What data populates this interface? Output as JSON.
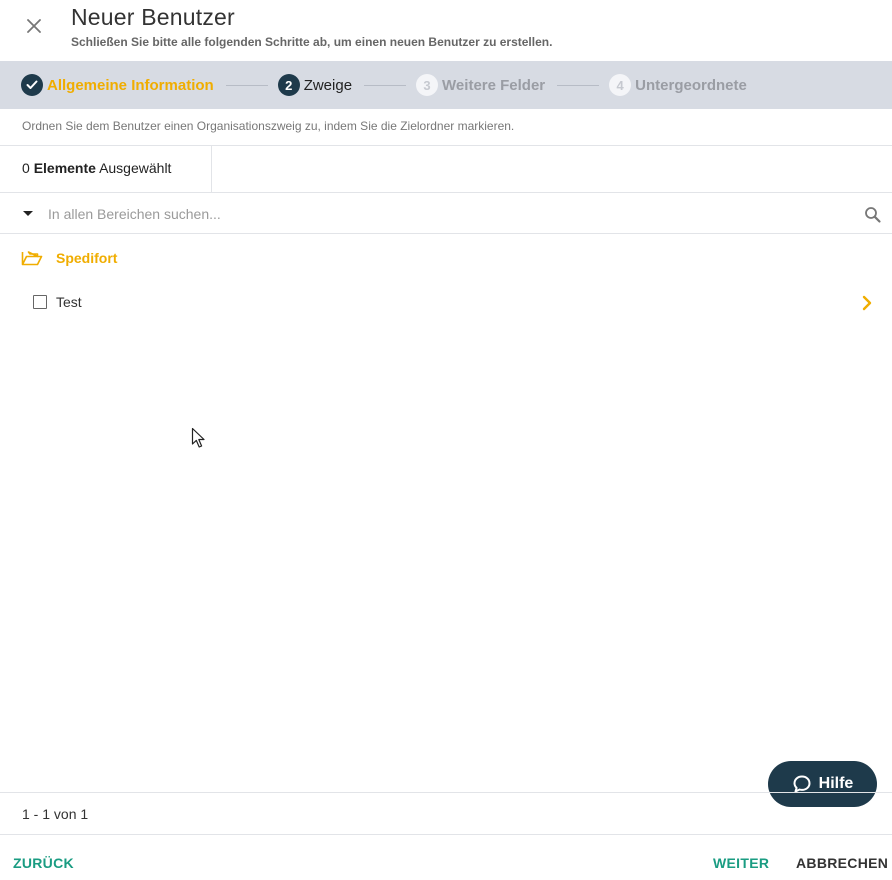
{
  "dialog": {
    "title": "Neuer Benutzer",
    "subtitle": "Schließen Sie bitte alle folgenden Schritte ab, um einen neuen Benutzer zu erstellen."
  },
  "stepper": {
    "steps": [
      {
        "number": "",
        "label": "Allgemeine Information",
        "state": "done"
      },
      {
        "number": "2",
        "label": "Zweige",
        "state": "active"
      },
      {
        "number": "3",
        "label": "Weitere Felder",
        "state": "pending"
      },
      {
        "number": "4",
        "label": "Untergeordnete",
        "state": "pending"
      }
    ]
  },
  "instruction": "Ordnen Sie dem Benutzer einen Organisationszweig zu, indem Sie die Zielordner markieren.",
  "selection": {
    "count": "0",
    "elements_label": "Elemente",
    "selected_label": "Ausgewählt"
  },
  "search": {
    "placeholder": "In allen Bereichen suchen...",
    "value": ""
  },
  "tree": {
    "root_label": "Spedifort",
    "items": [
      {
        "label": "Test",
        "checked": false
      }
    ]
  },
  "help": {
    "label": "Hilfe"
  },
  "pagination": {
    "text": "1 - 1 von 1"
  },
  "footer": {
    "back_label": "ZURÜCK",
    "next_label": "WEITER",
    "cancel_label": "ABBRECHEN"
  },
  "colors": {
    "accent_yellow": "#f0ad00",
    "navy": "#1e3a4b",
    "teal": "#1a9c82",
    "stepper_bg": "#d7dbe3"
  },
  "icons": {
    "close": "close-icon",
    "check": "check-icon",
    "search": "search-icon",
    "folder": "folder-open-icon",
    "chevron": "chevron-right-icon",
    "help": "chat-bubble-icon",
    "cursor": "mouse-cursor-icon"
  }
}
